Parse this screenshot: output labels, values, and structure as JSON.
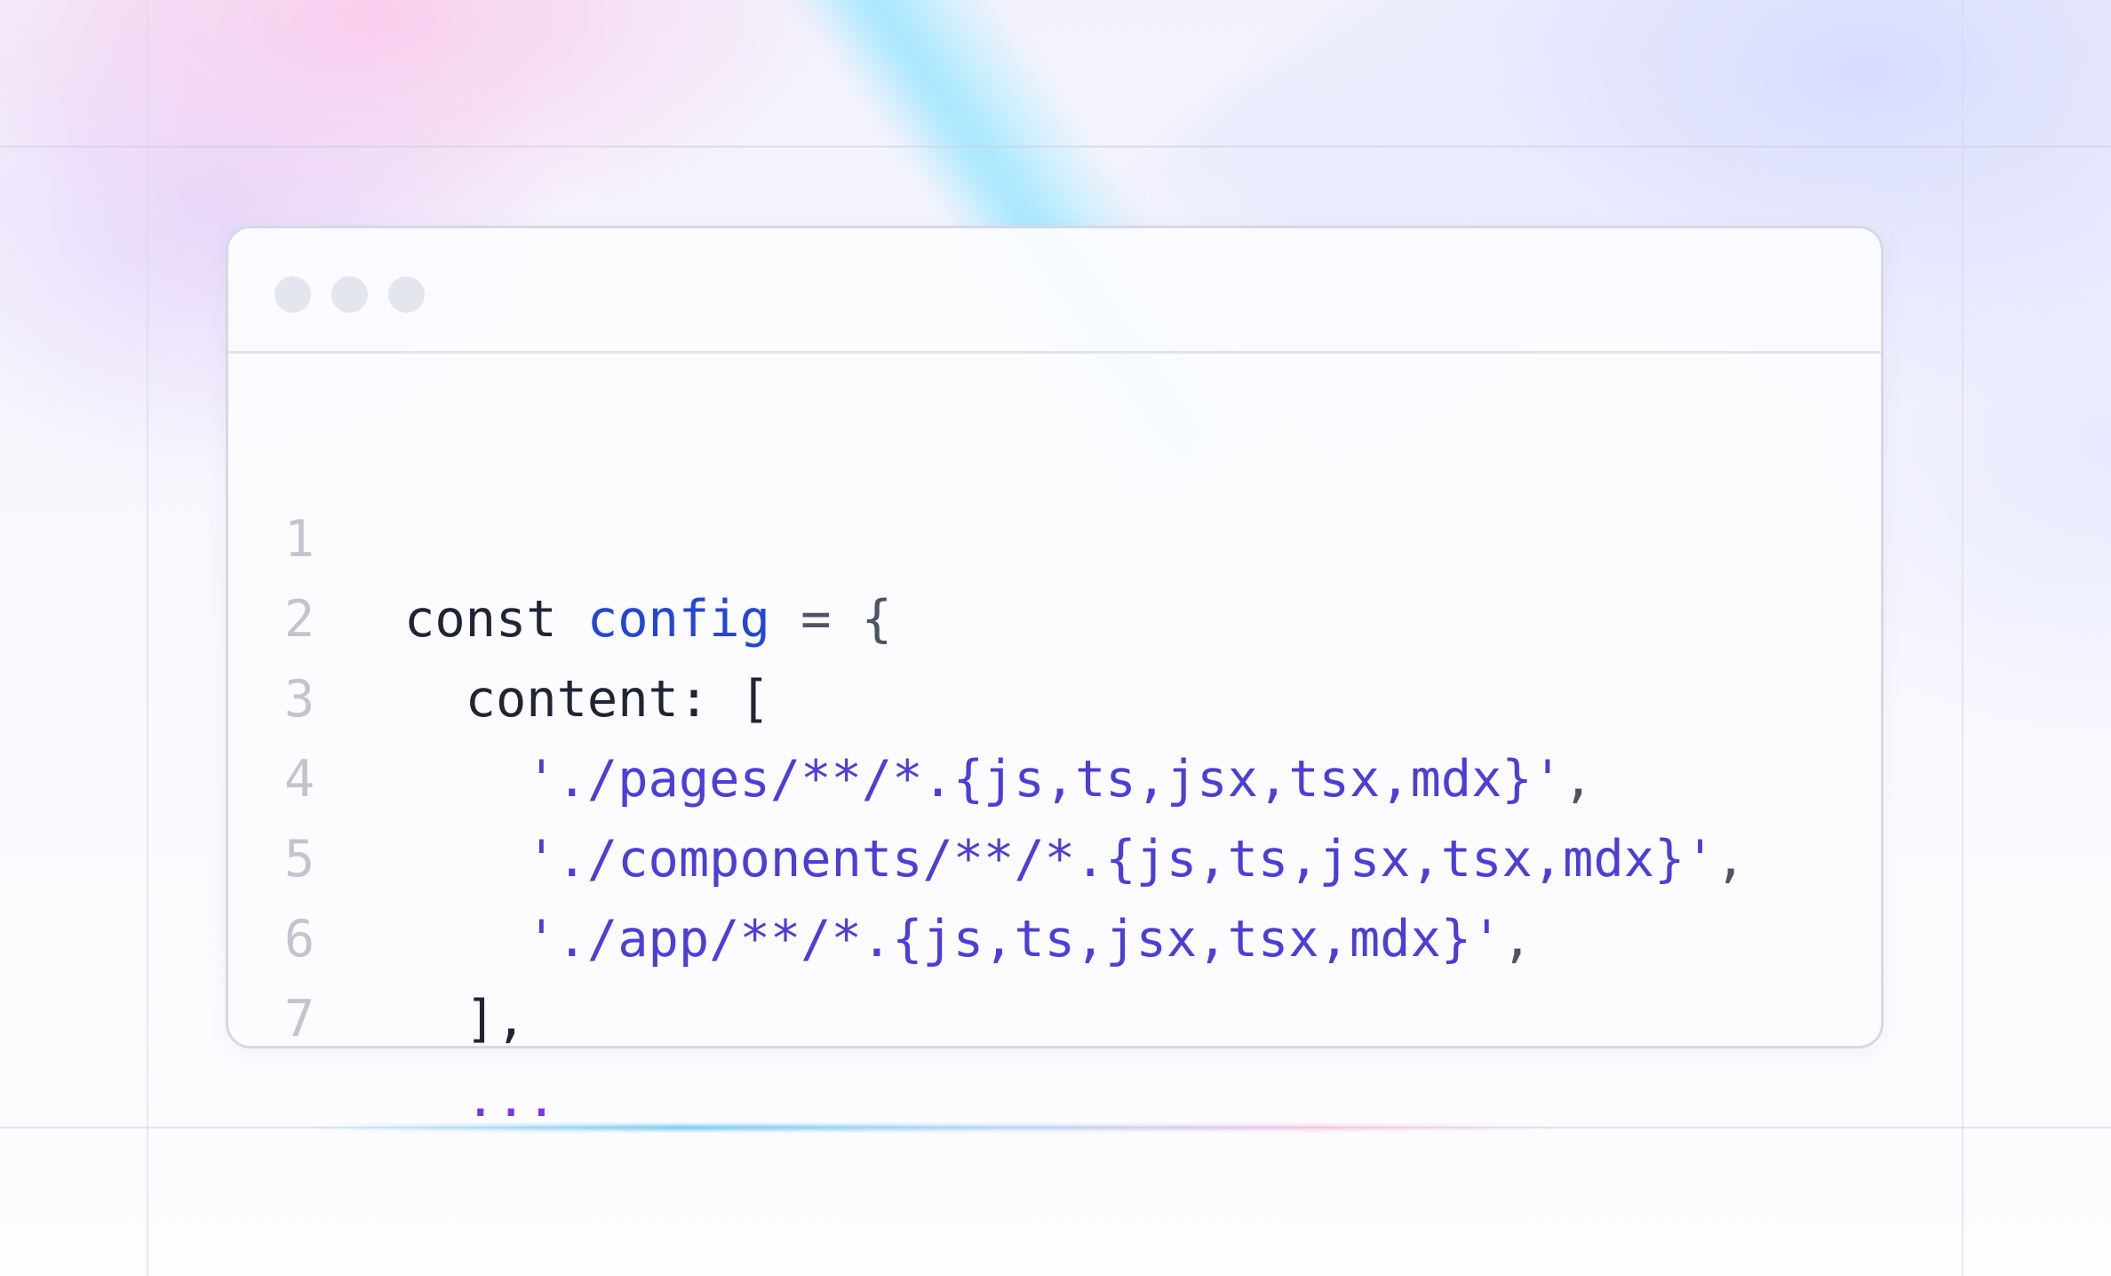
{
  "colors": {
    "keyword": "#1f2535",
    "identifier": "#2346d4",
    "punctuation": "#4d5464",
    "string": "#4b3fd6",
    "spread": "#7b36dc",
    "line_number": "#c2c5cf",
    "window_dot": "#e3e6ee"
  },
  "window": {
    "controls": [
      "dot",
      "dot",
      "dot"
    ]
  },
  "code": {
    "line_numbers": [
      "1",
      "2",
      "3",
      "4",
      "5",
      "6",
      "7"
    ],
    "lines": [
      {
        "indent": "",
        "tokens": [
          "const",
          " ",
          "config",
          " = {"
        ]
      },
      {
        "indent": "  ",
        "tokens": [
          "content",
          ": ["
        ]
      },
      {
        "indent": "    ",
        "tokens": [
          "'./pages/**/*.{js,ts,jsx,tsx,mdx}'",
          ","
        ]
      },
      {
        "indent": "    ",
        "tokens": [
          "'./components/**/*.{js,ts,jsx,tsx,mdx}'",
          ","
        ]
      },
      {
        "indent": "    ",
        "tokens": [
          "'./app/**/*.{js,ts,jsx,tsx,mdx}'",
          ","
        ]
      },
      {
        "indent": "  ",
        "tokens": [
          "],"
        ]
      },
      {
        "indent": "  ",
        "tokens": [
          "..."
        ]
      }
    ]
  }
}
